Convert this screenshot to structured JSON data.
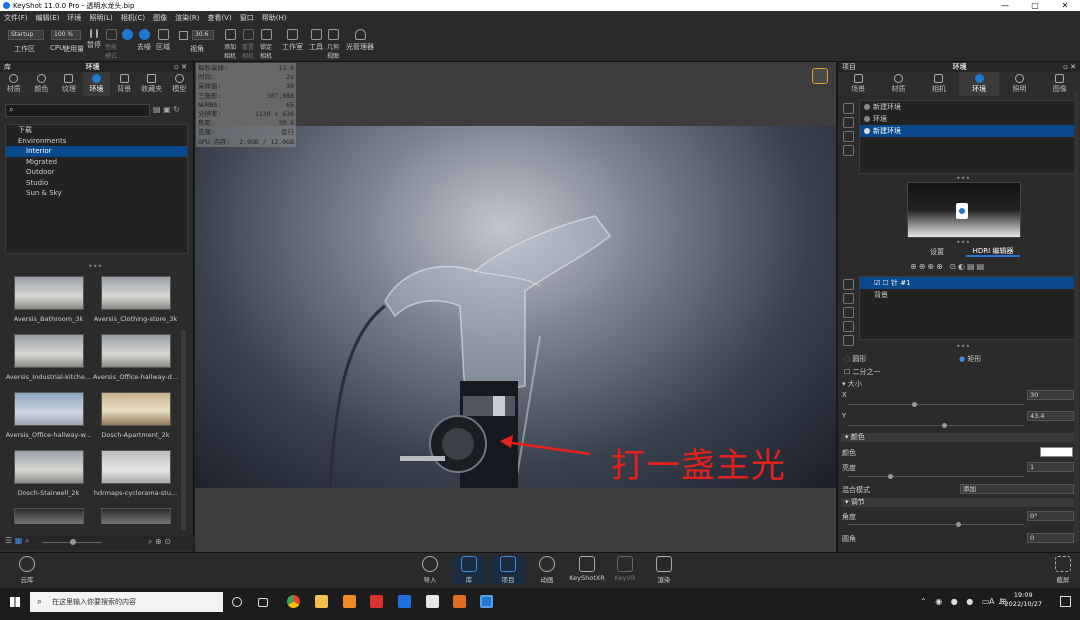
{
  "window": {
    "title": "KeyShot 11.0.0 Pro - 透明水龙头.bip",
    "minimize": "—",
    "maximize": "▢",
    "close": "✕"
  },
  "menu": [
    "文件(F)",
    "编辑(E)",
    "环境",
    "照明(L)",
    "相机(C)",
    "图像",
    "渲染(R)",
    "查看(V)",
    "窗口",
    "帮助(H)"
  ],
  "toolbar": {
    "workspace_select": "Startup",
    "workspace_label": "工作区",
    "cpu_label": "CPU",
    "usage_value": "100 %",
    "usage_label": "使用量",
    "pause_label": "暂停",
    "perf_label": "性能\n模式",
    "denoise_label": "去噪",
    "region_label": "区域",
    "fov_value": "30.6",
    "fov_label": "视角",
    "add_camera_label": "添加\n相机",
    "reset_camera_label": "重置\n相机",
    "lock_camera_label": "锁定\n相机",
    "studio_label": "工作室",
    "tools_label": "工具",
    "geometry_label": "几何\n视图",
    "light_manager_label": "光管理器"
  },
  "left_panel": {
    "title": "库",
    "header": "环境",
    "tabs": [
      {
        "label": "材质",
        "icon": "material-icon"
      },
      {
        "label": "颜色",
        "icon": "color-icon"
      },
      {
        "label": "纹理",
        "icon": "texture-icon"
      },
      {
        "label": "环境",
        "icon": "environment-icon",
        "active": true
      },
      {
        "label": "背景",
        "icon": "background-icon"
      },
      {
        "label": "收藏夹",
        "icon": "favorites-icon"
      },
      {
        "label": "模型",
        "icon": "model-icon"
      }
    ],
    "search_placeholder": "",
    "tree": [
      {
        "label": "下载",
        "indent": 1
      },
      {
        "label": "Environments",
        "indent": 0
      },
      {
        "label": "Interior",
        "indent": 2,
        "selected": true
      },
      {
        "label": "Migrated",
        "indent": 2
      },
      {
        "label": "Outdoor",
        "indent": 2
      },
      {
        "label": "Studio",
        "indent": 2
      },
      {
        "label": "Sun & Sky",
        "indent": 2
      }
    ],
    "thumbnails": [
      "Aversis_Bathroom_3k",
      "Aversis_Clothing-store_3k",
      "Aversis_Industrial-kitche...",
      "Aversis_Office-hallway-d...",
      "Aversis_Office-hallway-w...",
      "Dosch-Apartment_2k",
      "Dosch-Stairwell_2k",
      "hdrmaps-cyclorama-stu...",
      "",
      ""
    ]
  },
  "viewport": {
    "stats": [
      {
        "label": "每秒采样:",
        "value": "13.6"
      },
      {
        "label": "时间:",
        "value": "2s"
      },
      {
        "label": "采样值:",
        "value": "30"
      },
      {
        "label": "三角形:",
        "value": "307,088"
      },
      {
        "label": "NURBS:",
        "value": "65"
      },
      {
        "label": "分辨率:",
        "value": "1130 x 636"
      },
      {
        "label": "焦距:",
        "value": "39.6"
      },
      {
        "label": "去噪:",
        "value": "运行"
      },
      {
        "label": "GPU 内存:",
        "value": "2.9GB / 12.0GB"
      }
    ],
    "annotation": "打一盏主光"
  },
  "right_panel": {
    "title": "项目",
    "header": "环境",
    "tabs": [
      {
        "label": "场景",
        "icon": "scene-icon"
      },
      {
        "label": "材质",
        "icon": "material-icon"
      },
      {
        "label": "相机",
        "icon": "camera-icon"
      },
      {
        "label": "环境",
        "icon": "environment-icon",
        "active": true
      },
      {
        "label": "照明",
        "icon": "lighting-icon"
      },
      {
        "label": "图像",
        "icon": "image-icon"
      }
    ],
    "environments": [
      {
        "label": "新建环境"
      },
      {
        "label": "环境"
      },
      {
        "label": "新建环境",
        "selected": true
      }
    ],
    "subtabs": [
      "设置",
      "HDRI 编辑器"
    ],
    "pins": [
      {
        "label": "针 #1",
        "selected": true
      },
      {
        "label": "背景"
      }
    ],
    "shape": {
      "circle_label": "圆形",
      "rect_label": "矩形",
      "selected": "矩形"
    },
    "half_label": "二分之一",
    "size_section": "大小",
    "size_x_label": "X",
    "size_x_value": "30",
    "size_y_label": "Y",
    "size_y_value": "43.4",
    "color_section": "颜色",
    "color_label": "颜色",
    "color_value": "#ffffff",
    "brightness_label": "亮度",
    "brightness_value": "1",
    "blend_label": "混合模式",
    "blend_value": "添加",
    "adjust_section": "调节",
    "angle_label": "角度",
    "angle_value": "0°",
    "fillet_label": "圆角",
    "fillet_value": "0"
  },
  "bottom_bar": {
    "cloud_label": "云库",
    "items": [
      {
        "label": "导入",
        "icon": "import-icon"
      },
      {
        "label": "库",
        "icon": "library-icon",
        "active": true
      },
      {
        "label": "项目",
        "icon": "project-icon",
        "active": true
      },
      {
        "label": "动画",
        "icon": "animation-icon"
      },
      {
        "label": "KeyShotXR",
        "icon": "keyshotxr-icon"
      },
      {
        "label": "KeyVR",
        "icon": "keyvr-icon"
      },
      {
        "label": "渲染",
        "icon": "render-icon"
      }
    ],
    "screenshot_label": "截屏"
  },
  "taskbar": {
    "search_placeholder": "在这里输入你要搜索的内容",
    "time": "19:09",
    "date": "2022/10/27",
    "lang": "A"
  },
  "colors": {
    "accent": "#1f78d1",
    "selection": "#0a4a8c",
    "annotation_red": "#e8201a"
  }
}
